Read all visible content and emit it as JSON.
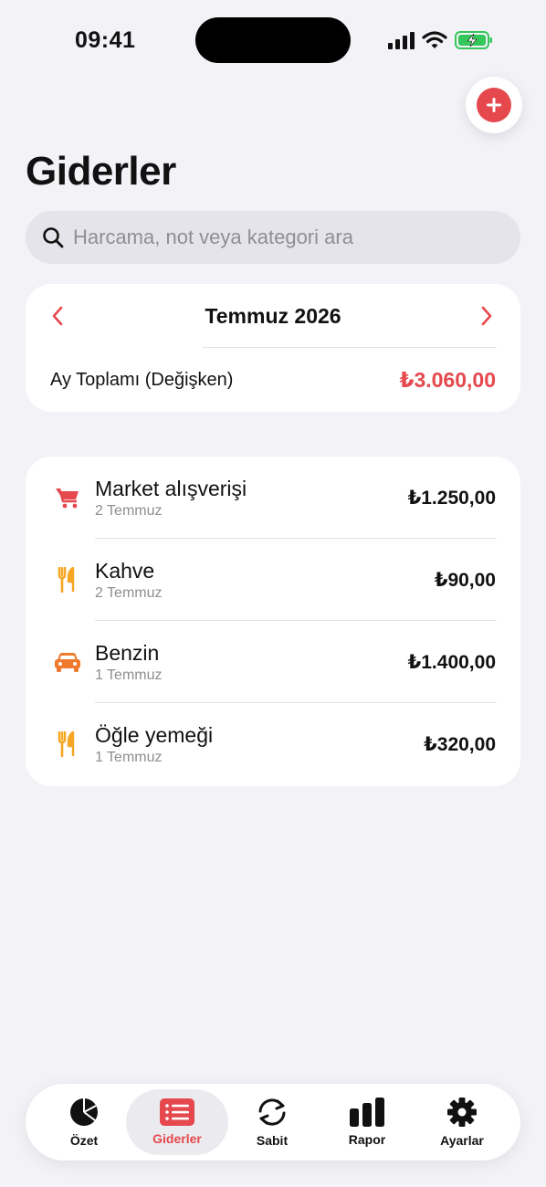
{
  "status_bar": {
    "time": "09:41"
  },
  "page": {
    "title": "Giderler"
  },
  "search": {
    "placeholder": "Harcama, not veya kategori ara"
  },
  "month": {
    "label": "Temmuz 2026",
    "total_label": "Ay Toplamı (Değişken)",
    "total_value": "₺3.060,00"
  },
  "expenses": [
    {
      "title": "Market alışverişi",
      "date": "2 Temmuz",
      "amount": "₺1.250,00",
      "icon": "cart-icon",
      "color": "#e5484d"
    },
    {
      "title": "Kahve",
      "date": "2 Temmuz",
      "amount": "₺90,00",
      "icon": "fork-knife-icon",
      "color": "#f5a623"
    },
    {
      "title": "Benzin",
      "date": "1 Temmuz",
      "amount": "₺1.400,00",
      "icon": "car-icon",
      "color": "#f07a2e"
    },
    {
      "title": "Öğle yemeği",
      "date": "1 Temmuz",
      "amount": "₺320,00",
      "icon": "fork-knife-icon",
      "color": "#f5a623"
    }
  ],
  "tabs": [
    {
      "label": "Özet",
      "icon": "pie-chart-icon"
    },
    {
      "label": "Giderler",
      "icon": "list-icon",
      "active": true
    },
    {
      "label": "Sabit",
      "icon": "repeat-icon"
    },
    {
      "label": "Rapor",
      "icon": "bar-chart-icon"
    },
    {
      "label": "Ayarlar",
      "icon": "gear-icon"
    }
  ],
  "colors": {
    "accent": "#e5484d",
    "background": "#f2f2f7",
    "battery": "#34c759"
  }
}
